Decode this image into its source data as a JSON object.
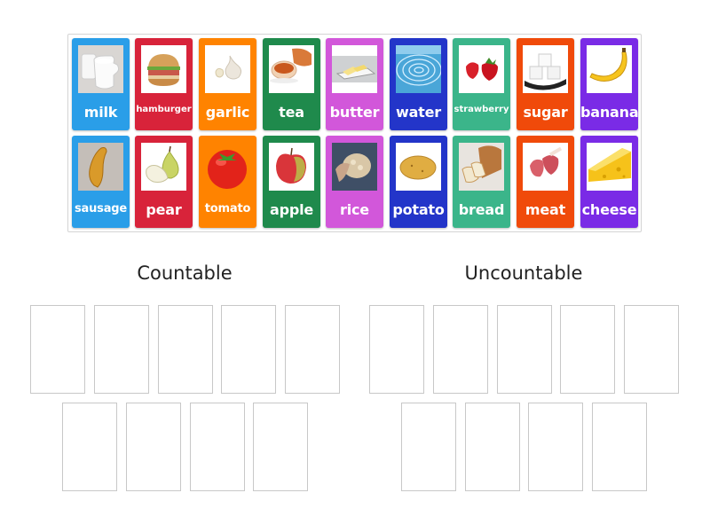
{
  "activity": {
    "cards": [
      {
        "label": "milk",
        "color": "#2a9ee8",
        "icon": "milk-icon",
        "size": "normal"
      },
      {
        "label": "hamburger",
        "color": "#d8233a",
        "icon": "hamburger-icon",
        "size": "small"
      },
      {
        "label": "garlic",
        "color": "#ff8300",
        "icon": "garlic-icon",
        "size": "normal"
      },
      {
        "label": "tea",
        "color": "#1f8a4c",
        "icon": "tea-icon",
        "size": "normal"
      },
      {
        "label": "butter",
        "color": "#d257da",
        "icon": "butter-icon",
        "size": "normal"
      },
      {
        "label": "water",
        "color": "#2335c9",
        "icon": "water-icon",
        "size": "normal"
      },
      {
        "label": "strawberry",
        "color": "#3bb58a",
        "icon": "strawberry-icon",
        "size": "small"
      },
      {
        "label": "sugar",
        "color": "#f04a0a",
        "icon": "sugar-icon",
        "size": "normal"
      },
      {
        "label": "banana",
        "color": "#7a2be6",
        "icon": "banana-icon",
        "size": "normal"
      },
      {
        "label": "sausage",
        "color": "#2a9ee8",
        "icon": "sausage-icon",
        "size": "mid"
      },
      {
        "label": "pear",
        "color": "#d8233a",
        "icon": "pear-icon",
        "size": "normal"
      },
      {
        "label": "tomato",
        "color": "#ff8300",
        "icon": "tomato-icon",
        "size": "mid"
      },
      {
        "label": "apple",
        "color": "#1f8a4c",
        "icon": "apple-icon",
        "size": "normal"
      },
      {
        "label": "rice",
        "color": "#d257da",
        "icon": "rice-icon",
        "size": "normal"
      },
      {
        "label": "potato",
        "color": "#2335c9",
        "icon": "potato-icon",
        "size": "normal"
      },
      {
        "label": "bread",
        "color": "#3bb58a",
        "icon": "bread-icon",
        "size": "normal"
      },
      {
        "label": "meat",
        "color": "#f04a0a",
        "icon": "meat-icon",
        "size": "normal"
      },
      {
        "label": "cheese",
        "color": "#7a2be6",
        "icon": "cheese-icon",
        "size": "normal"
      }
    ],
    "groups": [
      {
        "title": "Countable",
        "slot_count": 9
      },
      {
        "title": "Uncountable",
        "slot_count": 9
      }
    ]
  }
}
